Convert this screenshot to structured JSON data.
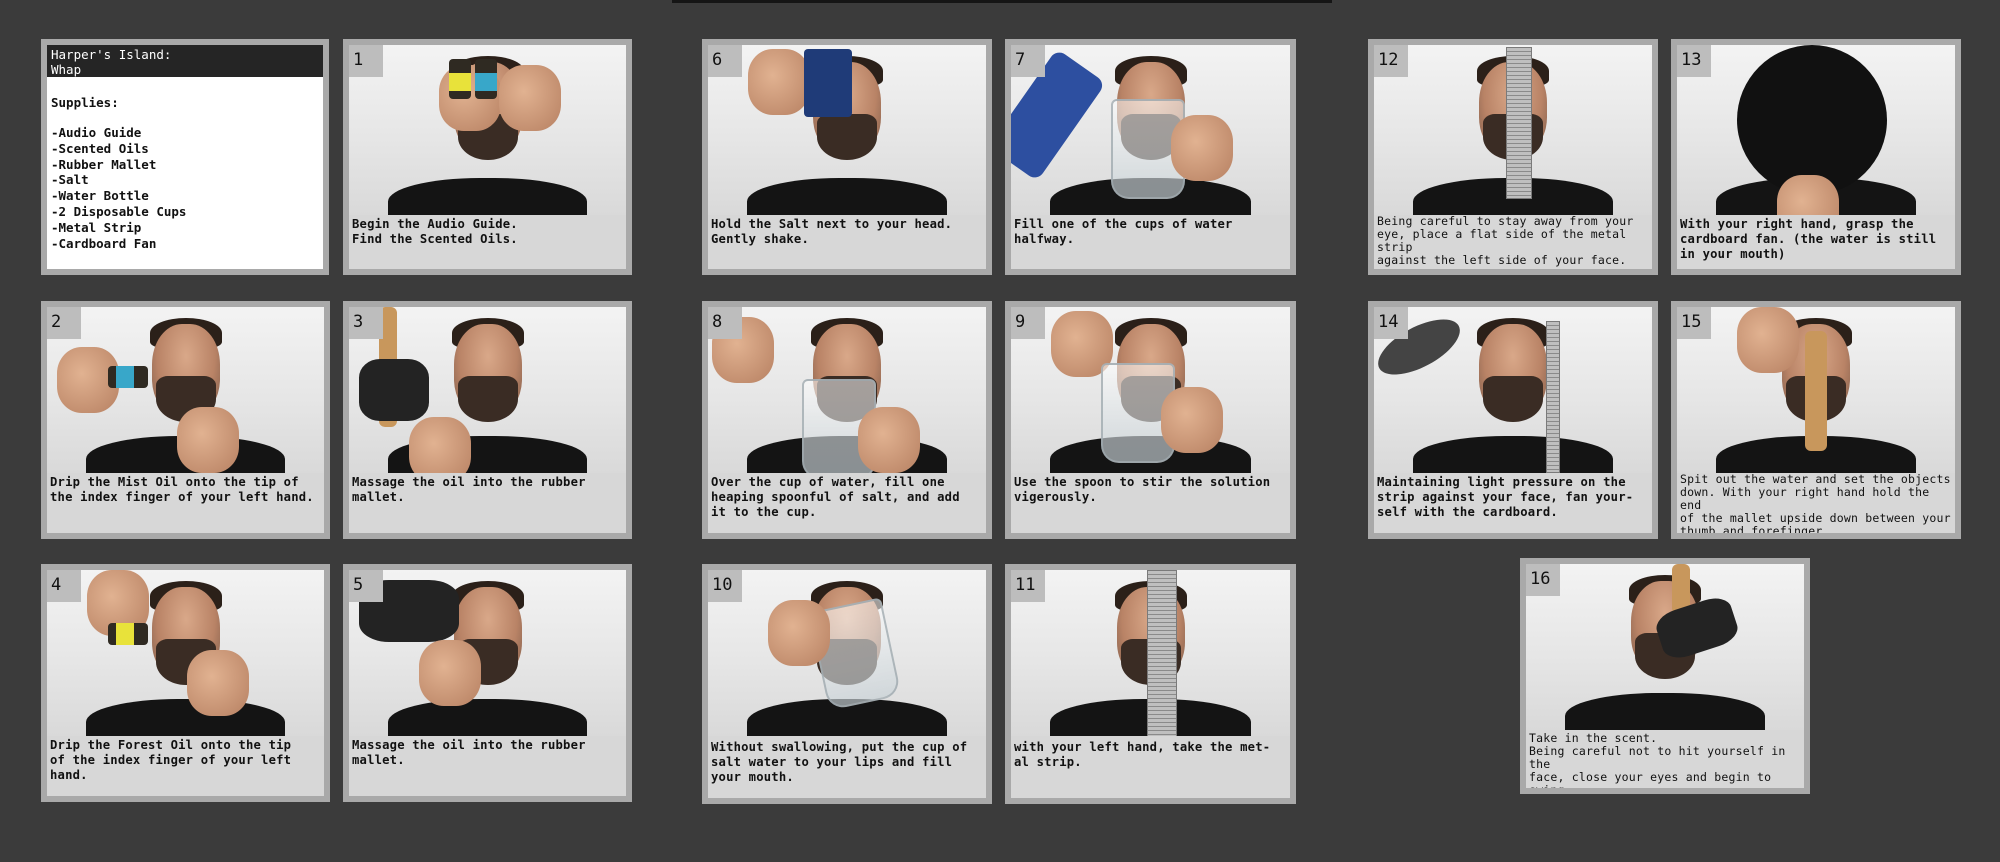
{
  "intro": {
    "title": "Harper's Island:\nWhap",
    "supplies_heading": "Supplies:",
    "supplies": [
      "-Audio Guide",
      "-Scented Oils",
      "-Rubber Mallet",
      "-Salt",
      "-Water Bottle",
      "-2 Disposable Cups",
      "-Metal Strip",
      "-Cardboard Fan"
    ]
  },
  "steps": [
    {
      "num": "1",
      "caption": "Begin the Audio Guide.\nFind the Scented Oils."
    },
    {
      "num": "2",
      "caption": "Drip the Mist Oil onto the tip of\nthe index finger of your left hand."
    },
    {
      "num": "3",
      "caption": "Massage the oil into the rubber\nmallet."
    },
    {
      "num": "4",
      "caption": "Drip the Forest Oil onto the tip\nof the index finger of your left\nhand."
    },
    {
      "num": "5",
      "caption": "Massage the oil into the rubber\nmallet."
    },
    {
      "num": "6",
      "caption": "Hold the Salt next to your head.\nGently shake."
    },
    {
      "num": "7",
      "caption": "Fill one of the cups of water\nhalfway."
    },
    {
      "num": "8",
      "caption": "Over the cup of water, fill one\nheaping spoonful of salt, and add\nit to the cup."
    },
    {
      "num": "9",
      "caption": "Use the spoon to stir the solution\nvigerously."
    },
    {
      "num": "10",
      "caption": "Without swallowing, put the cup of\nsalt water to your lips and fill\nyour mouth."
    },
    {
      "num": "11",
      "caption": "with your left hand, take the met-\nal strip."
    },
    {
      "num": "12",
      "caption": "Being careful to stay away from your\neye, place a flat side of the metal strip\nagainst the left side of your face."
    },
    {
      "num": "13",
      "caption": "With your right hand, grasp the\ncardboard fan. (the water is still\nin your mouth)"
    },
    {
      "num": "14",
      "caption": "Maintaining light pressure on the\nstrip against your face, fan your-\nself with the cardboard."
    },
    {
      "num": "15",
      "caption": "Spit out the water and set the objects\ndown.  With your right hand hold the end\nof the mallet upside down between your\nthumb and forefinger."
    },
    {
      "num": "16",
      "caption": "Take in the scent.\nBeing careful not to hit yourself in the\nface, close your eyes and begin to swing\nthe hammer."
    }
  ],
  "colors": {
    "background": "#3b3b3b",
    "card_frame": "#a9a9a9",
    "caption_panel": "#d7d7d7",
    "mist_label": "#38a7c9",
    "forest_label": "#e8e23a"
  },
  "icons": [
    "oil-bottle-icon",
    "rubber-mallet-icon",
    "salt-container-icon",
    "water-bottle-icon",
    "plastic-cup-icon",
    "metal-ruler-icon",
    "cardboard-fan-icon"
  ]
}
